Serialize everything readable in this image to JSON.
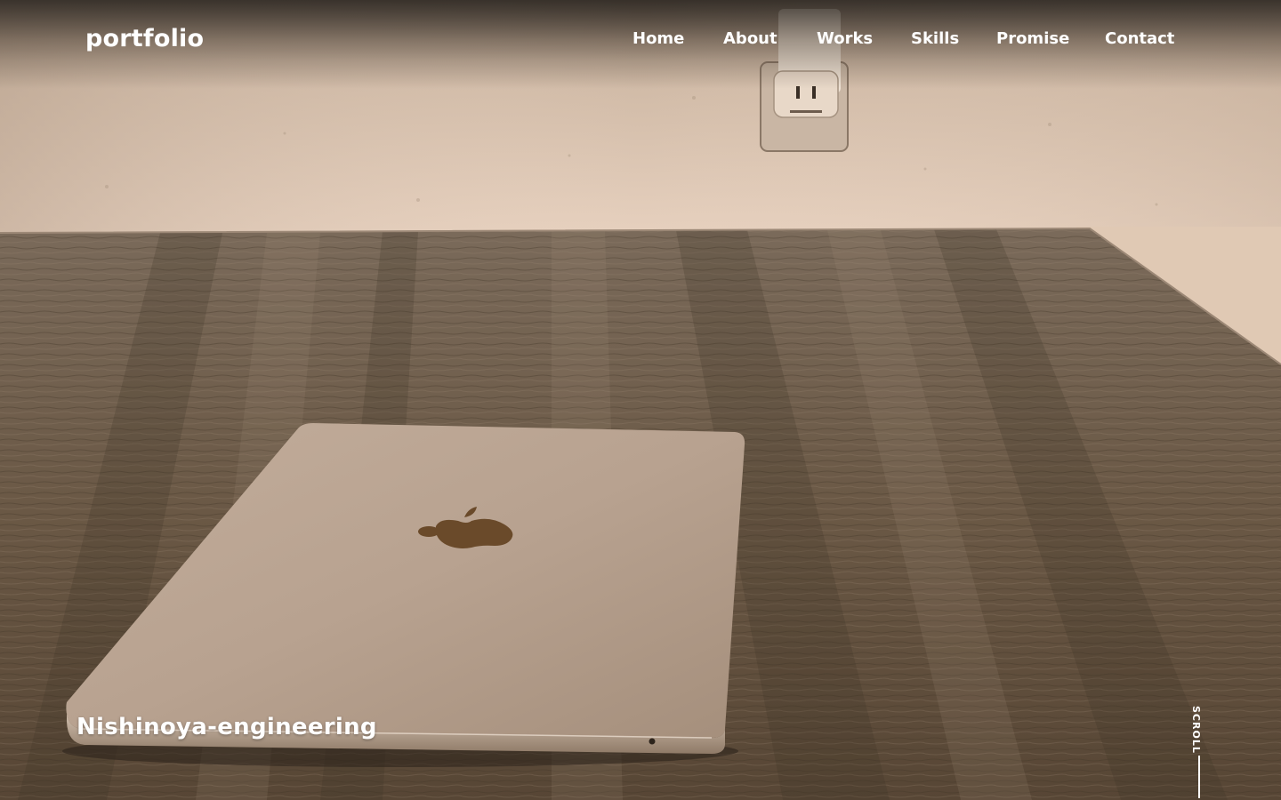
{
  "header": {
    "logo": "portfolio"
  },
  "nav": {
    "items": [
      {
        "label": "Home"
      },
      {
        "label": "About"
      },
      {
        "label": "Works"
      },
      {
        "label": "Skills"
      },
      {
        "label": "Promise"
      },
      {
        "label": "Contact"
      }
    ]
  },
  "hero": {
    "title": "Nishinoya-engineering",
    "scroll_label": "SCROLL",
    "background_description_icon": "laptop-on-wooden-table-photo"
  },
  "colors": {
    "text": "#ffffff",
    "wall": "#e8d3c0",
    "table": "#6b5a47",
    "laptop": "#c9b3a0"
  }
}
